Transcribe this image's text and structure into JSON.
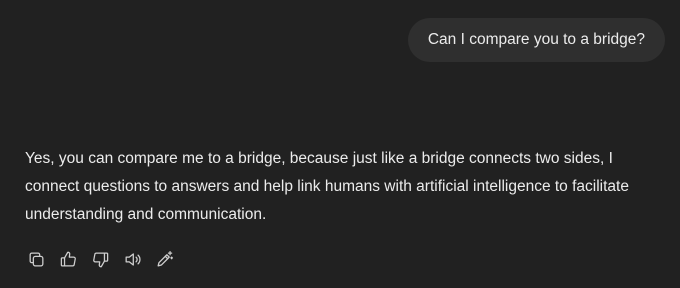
{
  "conversation": {
    "user_message": "Can I compare you to a bridge?",
    "assistant_message": "Yes, you can compare me to a bridge, because just like a bridge connects two sides, I connect questions to answers and help link humans with artificial intelligence to facilitate understanding and communication."
  },
  "actions": [
    {
      "name": "copy",
      "icon": "copy-icon"
    },
    {
      "name": "good-response",
      "icon": "thumbs-up-icon"
    },
    {
      "name": "bad-response",
      "icon": "thumbs-down-icon"
    },
    {
      "name": "read-aloud",
      "icon": "speaker-icon"
    },
    {
      "name": "edit",
      "icon": "edit-sparkle-icon"
    }
  ],
  "colors": {
    "background": "#212121",
    "user_bubble": "#2f2f2f",
    "text": "#ececec",
    "icon": "#cfcfcf"
  }
}
